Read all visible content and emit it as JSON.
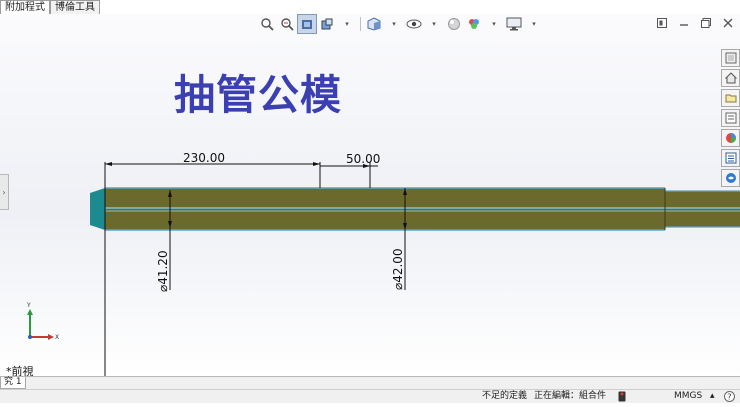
{
  "tabs": [
    {
      "label": "附加程式"
    },
    {
      "label": "博倫工具"
    }
  ],
  "note_title": "抽管公模",
  "dimensions": {
    "d1": "230.00",
    "d2": "50.00",
    "dia1": "⌀41.20",
    "dia2": "⌀42.00"
  },
  "view_label": "*前視",
  "sheet_tab": "究 1",
  "status": {
    "under_defined": "不足的定義",
    "editing": "正在編輯：組合件",
    "units": "MMGS"
  },
  "triad": {
    "y": "Y",
    "x": "X"
  },
  "colors": {
    "part_fill": "#6b6a2c",
    "part_edge": "#5ea3c4",
    "chamfer": "#1c8a8e",
    "note": "#3b3fb2"
  }
}
